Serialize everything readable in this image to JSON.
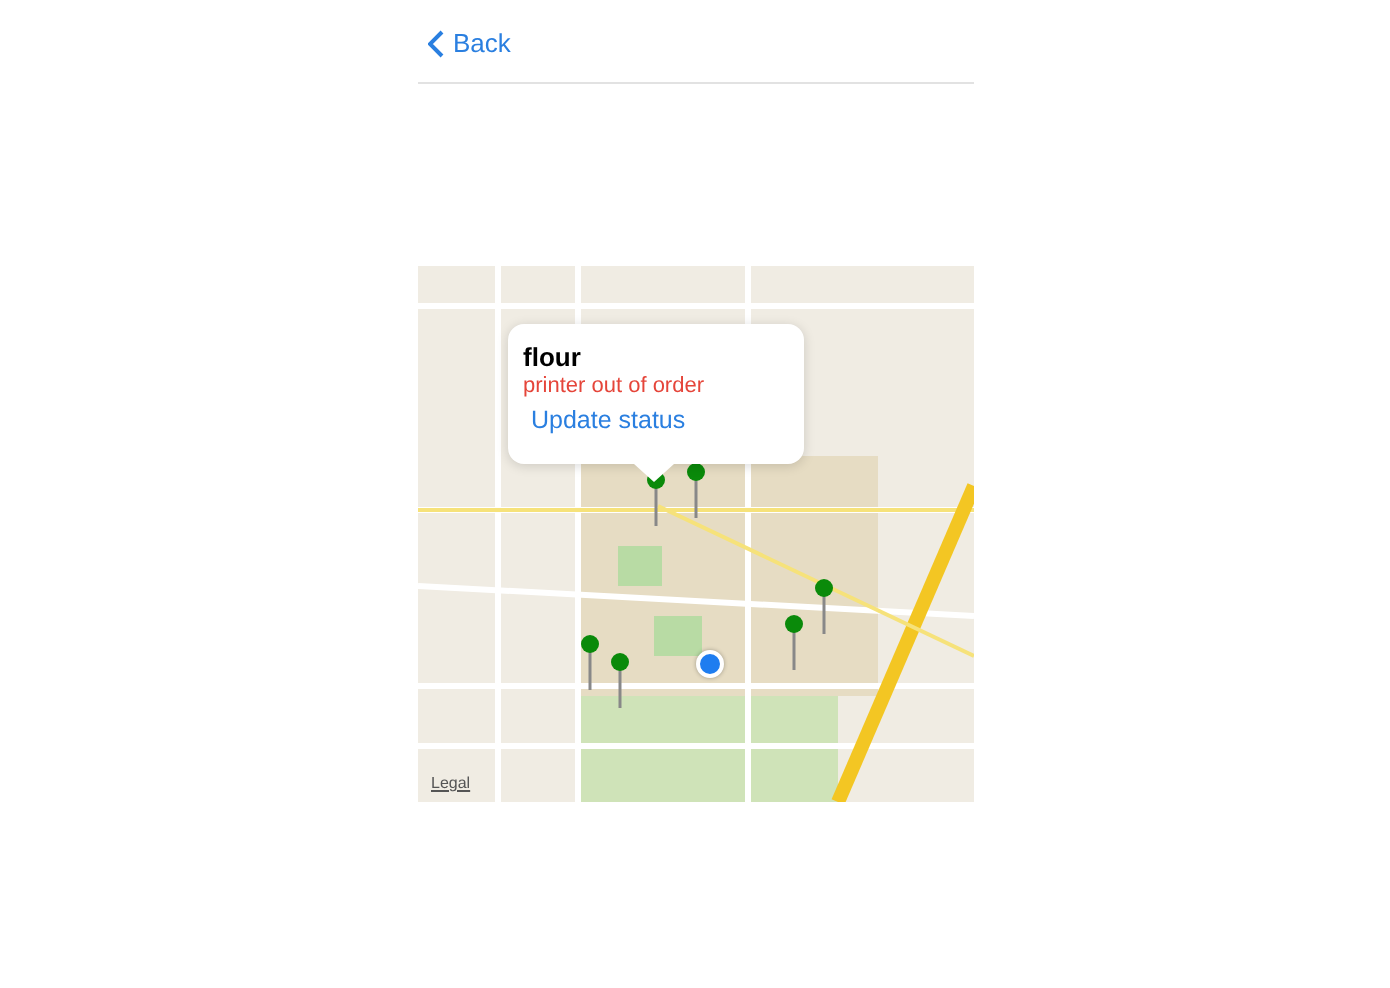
{
  "nav": {
    "back_label": "Back"
  },
  "map": {
    "callout": {
      "title": "flour",
      "subtitle": "printer out of order",
      "action": "Update status"
    },
    "legal": "Legal"
  }
}
